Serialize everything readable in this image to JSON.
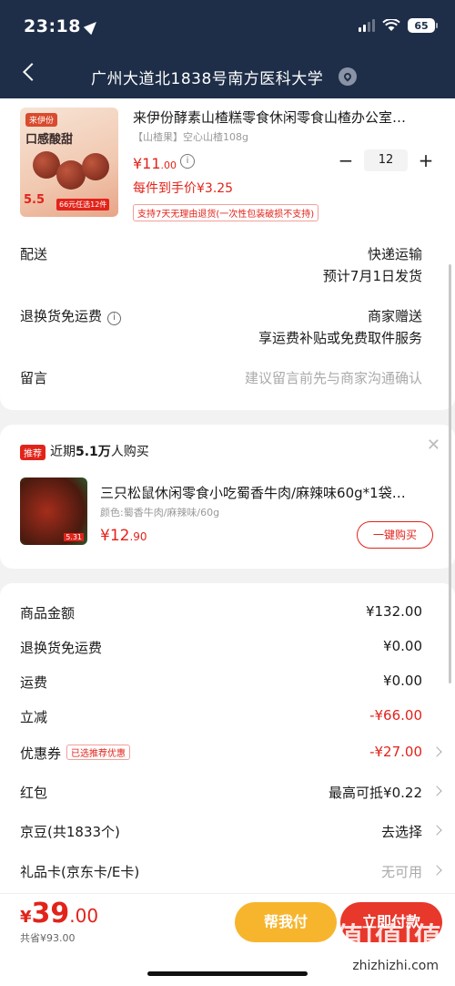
{
  "status": {
    "time": "23:18",
    "battery": "65"
  },
  "header": {
    "address": "广州大道北1838号南方医科大学"
  },
  "product": {
    "title": "来伊份酵素山楂糕零食休闲零食山楂办公室…",
    "spec": "【山楂果】空心山楂108g",
    "price_main": "¥11",
    "price_dec": ".00",
    "unit_price": "每件到手价¥3.25",
    "return_policy": "支持7天无理由退货(一次性包装破损不支持)",
    "quantity": "12",
    "image_text": {
      "brand": "来伊份",
      "slogan": "口感酸甜",
      "promo_price": "5.5",
      "promo_band": "66元任选12件"
    }
  },
  "delivery": {
    "label": "配送",
    "value": "快递运输",
    "eta": "预计7月1日发货"
  },
  "return_shipping": {
    "label": "退换货免运费",
    "value": "商家赠送",
    "desc": "享运费补贴或免费取件服务"
  },
  "message": {
    "label": "留言",
    "placeholder": "建议留言前先与商家沟通确认"
  },
  "recommend": {
    "tag": "推荐",
    "text_prefix": "近期",
    "count": "5.1万",
    "text_suffix": "人购买",
    "title": "三只松鼠休闲零食小吃蜀香牛肉/麻辣味60g*1袋…",
    "spec": "颜色:蜀香牛肉/麻辣味/60g",
    "price_main": "¥12",
    "price_dec": ".90",
    "buy_label": "一键购买",
    "image_tag": "5.31"
  },
  "summary": [
    {
      "label": "商品金额",
      "value": "¥132.00",
      "red": false,
      "arrow": false
    },
    {
      "label": "退换货免运费",
      "value": "¥0.00",
      "red": false,
      "arrow": false
    },
    {
      "label": "运费",
      "value": "¥0.00",
      "red": false,
      "arrow": false
    },
    {
      "label": "立减",
      "value": "-¥66.00",
      "red": true,
      "arrow": false
    },
    {
      "label": "优惠券",
      "chip": "已选推荐优惠",
      "value": "-¥27.00",
      "red": true,
      "arrow": true
    },
    {
      "label": "红包",
      "value": "最高可抵¥0.22",
      "red": false,
      "arrow": true
    },
    {
      "label": "京豆(共1833个)",
      "value": "去选择",
      "red": false,
      "arrow": true
    },
    {
      "label": "礼品卡(京东卡/E卡)",
      "value": "无可用",
      "red": false,
      "grey": true,
      "arrow": true
    }
  ],
  "bottom": {
    "yen": "¥",
    "total_int": "39",
    "total_dec": ".00",
    "saved": "共省¥93.00",
    "help_pay": "帮我付",
    "pay": "立即付款"
  },
  "watermark": {
    "text": "值|值|值",
    "url": "zhizhizhi.com"
  }
}
